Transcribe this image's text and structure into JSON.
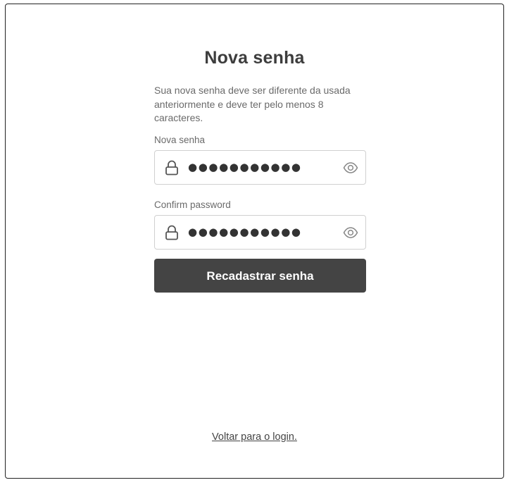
{
  "page": {
    "title": "Nova senha",
    "description": "Sua nova senha deve ser diferente da usada anteriormente e deve ter pelo menos 8 caracteres."
  },
  "new_password": {
    "label": "Nova senha",
    "masked_value": "●●●●●●●●●●●",
    "lead_icon": "lock-icon",
    "trail_icon": "eye-icon"
  },
  "confirm_password": {
    "label": "Confirm password",
    "masked_value": "●●●●●●●●●●●",
    "lead_icon": "lock-icon",
    "trail_icon": "eye-icon"
  },
  "submit": {
    "label": "Recadastrar senha"
  },
  "back_link": {
    "label": "Voltar para o login."
  },
  "colors": {
    "button_bg": "#444444",
    "text_dark": "#3d3d3d",
    "text_muted": "#6a6a6a",
    "border": "#d0d0d0"
  }
}
